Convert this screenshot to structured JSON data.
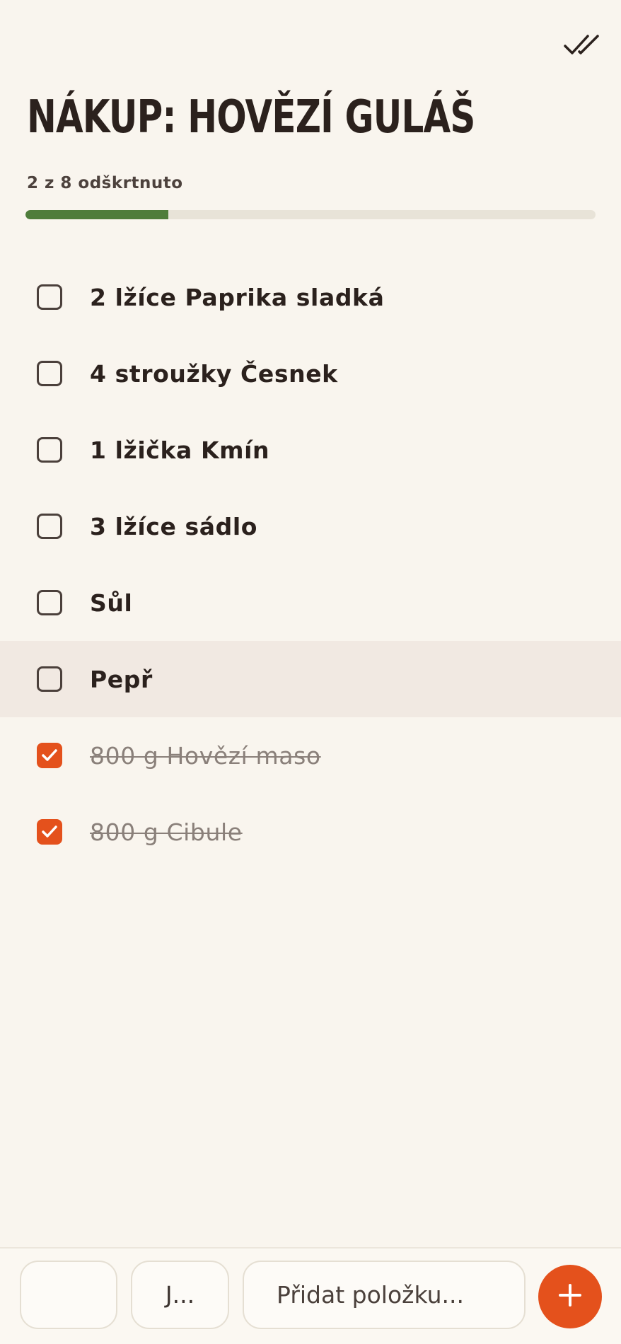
{
  "header": {
    "title": "NÁKUP: HOVĚZÍ GULÁŠ",
    "check_all_icon": "double-check-icon",
    "progress_text": "2 z 8 odškrtnuto",
    "progress_checked": 2,
    "progress_total": 8
  },
  "items": [
    {
      "label": "2 lžíce Paprika sladká",
      "checked": false
    },
    {
      "label": "4 stroužky Česnek",
      "checked": false
    },
    {
      "label": "1 lžička Kmín",
      "checked": false
    },
    {
      "label": "3 lžíce sádlo",
      "checked": false
    },
    {
      "label": "Sůl",
      "checked": false
    },
    {
      "label": "Pepř",
      "checked": false
    },
    {
      "label": "800 g Hovězí maso",
      "checked": true
    },
    {
      "label": "800 g Cibule",
      "checked": true
    }
  ],
  "add_bar": {
    "quantity_value": "",
    "unit_value": "J...",
    "name_placeholder": "Přidat položku...",
    "add_icon": "plus-icon"
  },
  "colors": {
    "accent": "#e4511c",
    "progress": "#4f7d3b",
    "background": "#f9f5ee"
  }
}
